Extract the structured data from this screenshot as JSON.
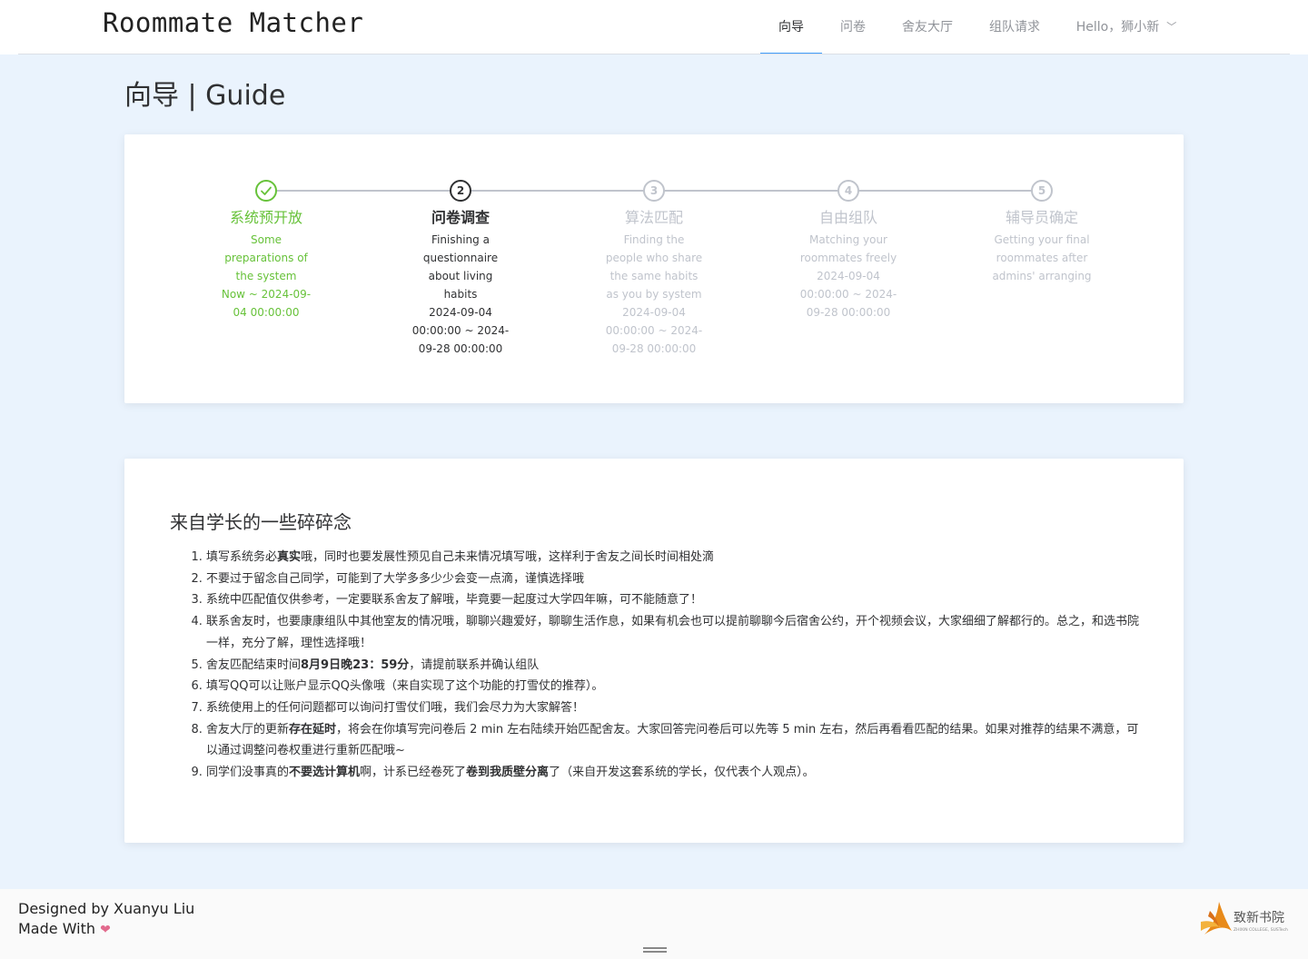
{
  "header": {
    "brand": "Roommate Matcher",
    "nav": [
      {
        "label": "向导",
        "active": true
      },
      {
        "label": "问卷",
        "active": false
      },
      {
        "label": "舍友大厅",
        "active": false
      },
      {
        "label": "组队请求",
        "active": false
      }
    ],
    "user_menu": "Hello，狮小新"
  },
  "page_title": "向导 | Guide",
  "steps": [
    {
      "status": "success",
      "icon": "check-icon",
      "title": "系统预开放",
      "desc": "Some preparations of the system",
      "time": "Now ~ 2024-09-04 00:00:00"
    },
    {
      "status": "process",
      "icon": "2",
      "title": "问卷调查",
      "desc": "Finishing a questionnaire about living habits",
      "time": "2024-09-04 00:00:00 ~ 2024-09-28 00:00:00"
    },
    {
      "status": "wait",
      "icon": "3",
      "title": "算法匹配",
      "desc": "Finding the people who share the same habits as you by system",
      "time": "2024-09-04 00:00:00 ~ 2024-09-28 00:00:00"
    },
    {
      "status": "wait",
      "icon": "4",
      "title": "自由组队",
      "desc": "Matching your roommates freely",
      "time": "2024-09-04 00:00:00 ~ 2024-09-28 00:00:00"
    },
    {
      "status": "wait",
      "icon": "5",
      "title": "辅导员确定",
      "desc": "Getting your final roommates after admins' arranging",
      "time": ""
    }
  ],
  "notes": {
    "title": "来自学长的一些碎碎念",
    "items": [
      [
        {
          "t": "填写系统务必"
        },
        {
          "t": "真实",
          "b": true
        },
        {
          "t": "哦，同时也要发展性预见自己未来情况填写哦，这样利于舍友之间长时间相处滴"
        }
      ],
      [
        {
          "t": "不要过于留念自己同学，可能到了大学多多少少会变一点滴，谨慎选择哦"
        }
      ],
      [
        {
          "t": "系统中匹配值仅供参考，一定要联系舍友了解哦，毕竟要一起度过大学四年嘛，可不能随意了！"
        }
      ],
      [
        {
          "t": "联系舍友时，也要康康组队中其他室友的情况哦，聊聊兴趣爱好，聊聊生活作息，如果有机会也可以提前聊聊今后宿舍公约，开个视频会议，大家细细了解都行的。总之，和选书院一样，充分了解，理性选择哦！"
        }
      ],
      [
        {
          "t": "舍友匹配结束时间"
        },
        {
          "t": "8月9日晚23：59分",
          "b": true
        },
        {
          "t": "，请提前联系并确认组队"
        }
      ],
      [
        {
          "t": "填写QQ可以让账户显示QQ头像哦（来自实现了这个功能的打雪仗的推荐）。"
        }
      ],
      [
        {
          "t": "系统使用上的任何问题都可以询问打雪仗们哦，我们会尽力为大家解答！"
        }
      ],
      [
        {
          "t": "舍友大厅的更新"
        },
        {
          "t": "存在延时",
          "b": true
        },
        {
          "t": "，将会在你填写完问卷后 2 min 左右陆续开始匹配舍友。大家回答完问卷后可以先等 5 min 左右，然后再看看匹配的结果。如果对推荐的结果不满意，可以通过调整问卷权重进行重新匹配哦~"
        }
      ],
      [
        {
          "t": "同学们没事真的"
        },
        {
          "t": "不要选计算机",
          "b": true
        },
        {
          "t": "啊，计系已经卷死了"
        },
        {
          "t": "卷到我质壁分离",
          "b": true
        },
        {
          "t": "了（来自开发这套系统的学长，仅代表个人观点）。"
        }
      ]
    ]
  },
  "footer": {
    "designed_by": "Designed by Xuanyu Liu",
    "made_with": "Made With",
    "heart_icon": "heart-icon",
    "logo_text": "致新书院",
    "logo_subtext": "ZHIXIN COLLEGE, SUSTech"
  },
  "colors": {
    "success": "#67c23a",
    "process": "#303133",
    "wait": "#c0c4cc",
    "nav_active": "#409eff",
    "page_bg": "#eaf3fd",
    "logo_orange": "#e88a1a"
  }
}
